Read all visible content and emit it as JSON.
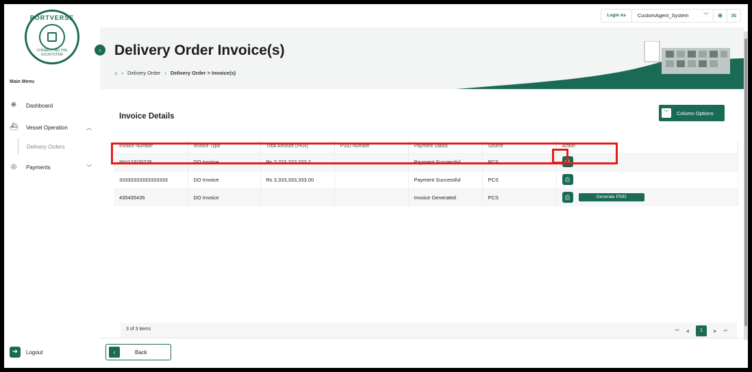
{
  "logo": {
    "top": "PORTVERSE",
    "bottom": "CONNECTING THE ECOSYSTEM"
  },
  "sidebar": {
    "main_menu": "Main Menu",
    "items": [
      {
        "label": "Dashboard"
      },
      {
        "label": "Vessel Operation"
      },
      {
        "label": "Delivery Orders"
      },
      {
        "label": "Payments"
      }
    ],
    "logout": "Logout"
  },
  "topbar": {
    "login_as": "Login As",
    "agent": "CustomAgent_System"
  },
  "header": {
    "title": "Delivery Order Invoice(s)",
    "breadcrumb": [
      "Delivery Order",
      "Delivery Order > Invoice(s)"
    ]
  },
  "card": {
    "title": "Invoice Details",
    "column_options": "Column Options"
  },
  "table": {
    "headers": [
      "Invoice Number",
      "Invoice Type",
      "Total Amount (PKR)",
      "PSID Number",
      "Payment Status",
      "Source",
      "Action"
    ],
    "rows": [
      {
        "invoice": "INV123/20225",
        "type": "DO Invoice",
        "amount": "Rs 2,222,222,222.2...",
        "psid": "",
        "status": "Payment Successful",
        "source": "PCS"
      },
      {
        "invoice": "33333333333333333",
        "type": "DO Invoice",
        "amount": "Rs 3,333,333,333.00",
        "psid": "",
        "status": "Payment Successful",
        "source": "PCS"
      },
      {
        "invoice": "435435435",
        "type": "DO Invoice",
        "amount": "",
        "psid": "",
        "status": "Invoice Generated",
        "source": "PCS"
      }
    ],
    "generate_psid": "Generate PSID"
  },
  "footer": {
    "items_text": "3 of 3 items",
    "current_page": "1"
  },
  "bottom": {
    "back": "Back"
  },
  "colors": {
    "brand": "#1a6a55",
    "highlight": "#e41b1b"
  }
}
